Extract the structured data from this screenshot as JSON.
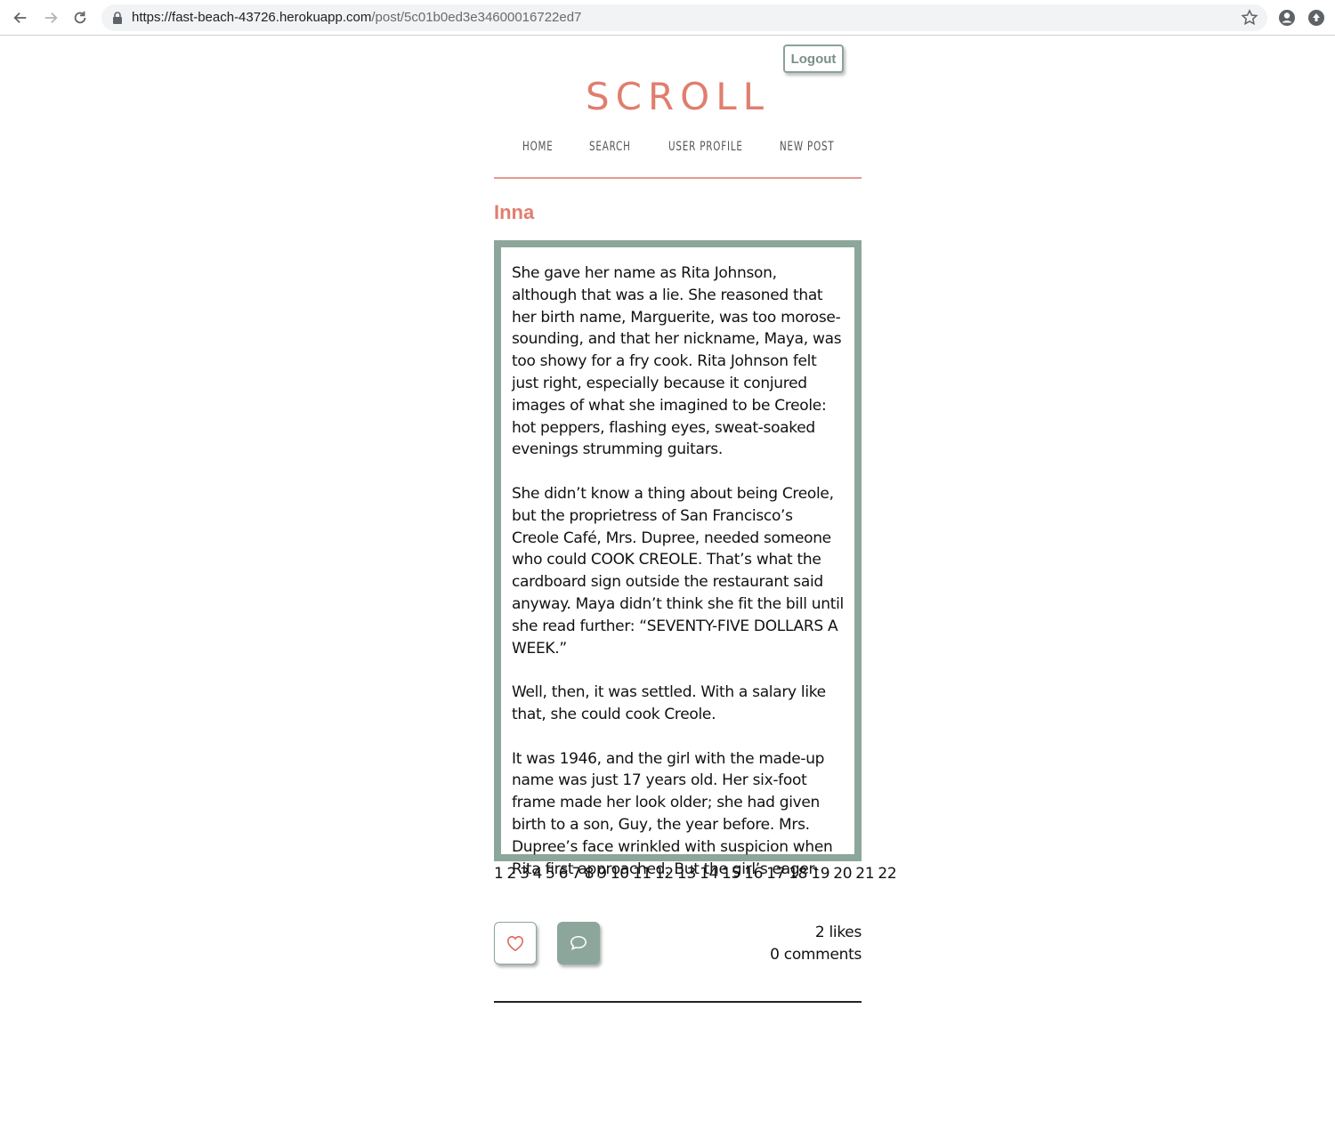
{
  "browser": {
    "url_host": "https://fast-beach-43726.herokuapp.com",
    "url_path": "/post/5c01b0ed3e34600016722ed7"
  },
  "header": {
    "logout_label": "Logout",
    "brand": "SCROLL",
    "nav": [
      "HOME",
      "SEARCH",
      "USER PROFILE",
      "NEW POST"
    ]
  },
  "post": {
    "author": "Inna",
    "paragraphs": [
      "She gave her name as Rita Johnson, although that was a lie. She reasoned that her birth name, Marguerite, was too morose-sounding, and that her nickname, Maya, was too showy for a fry cook. Rita Johnson felt just right, especially because it conjured images of what she imagined to be Creole: hot peppers, flashing eyes, sweat-soaked evenings strumming guitars.",
      "She didn’t know a thing about being Creole, but the proprietress of San Francisco’s Creole Café, Mrs. Dupree, needed someone who could COOK CREOLE. That’s what the cardboard sign outside the restaurant said anyway. Maya didn’t think she fit the bill until she read further: “SEVENTY-FIVE DOLLARS A WEEK.”",
      "Well, then, it was settled. With a salary like that, she could cook Creole.",
      "It was 1946, and the girl with the made-up name was just 17 years old. Her six-foot frame made her look older; she had given birth to a son, Guy, the year before. Mrs. Dupree’s face wrinkled with suspicion when Rita first approached. But the girl’s eager-"
    ],
    "pages": [
      "1",
      "2",
      "3",
      "4",
      "5",
      "6",
      "7",
      "8",
      "9",
      "10",
      "11",
      "12",
      "13",
      "14",
      "15",
      "16",
      "17",
      "18",
      "19",
      "20",
      "21",
      "22"
    ],
    "likes": "2 likes",
    "comments": "0 comments"
  },
  "colors": {
    "accent": "#e07e6e",
    "sage": "#8da69b"
  },
  "icons": {
    "like": "heart-icon",
    "comment": "speech-bubble-icon"
  }
}
